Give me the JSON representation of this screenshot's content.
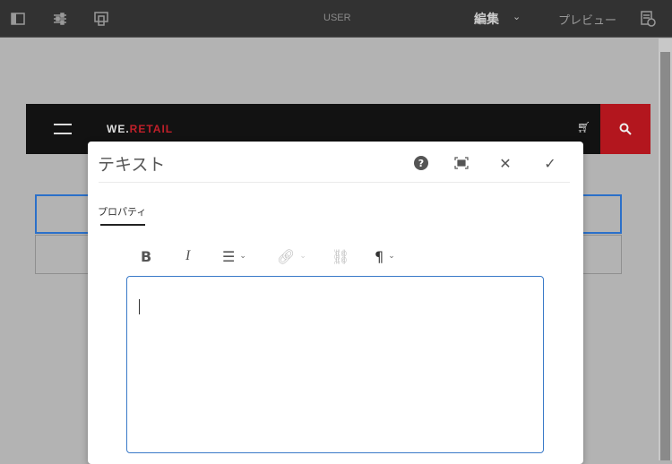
{
  "topbar": {
    "user_label": "USER",
    "edit_label": "編集",
    "preview_label": "プレビュー"
  },
  "site": {
    "logo_we": "WE.",
    "logo_retail": "RETAIL"
  },
  "dialog": {
    "title": "テキスト",
    "tabs": [
      {
        "label": "プロパティ"
      }
    ],
    "toolbar": {
      "bold": "B",
      "italic": "I",
      "paragraph": "¶"
    },
    "editor_value": ""
  },
  "colors": {
    "accent": "#2b70c9",
    "brand_red": "#b3161e"
  }
}
